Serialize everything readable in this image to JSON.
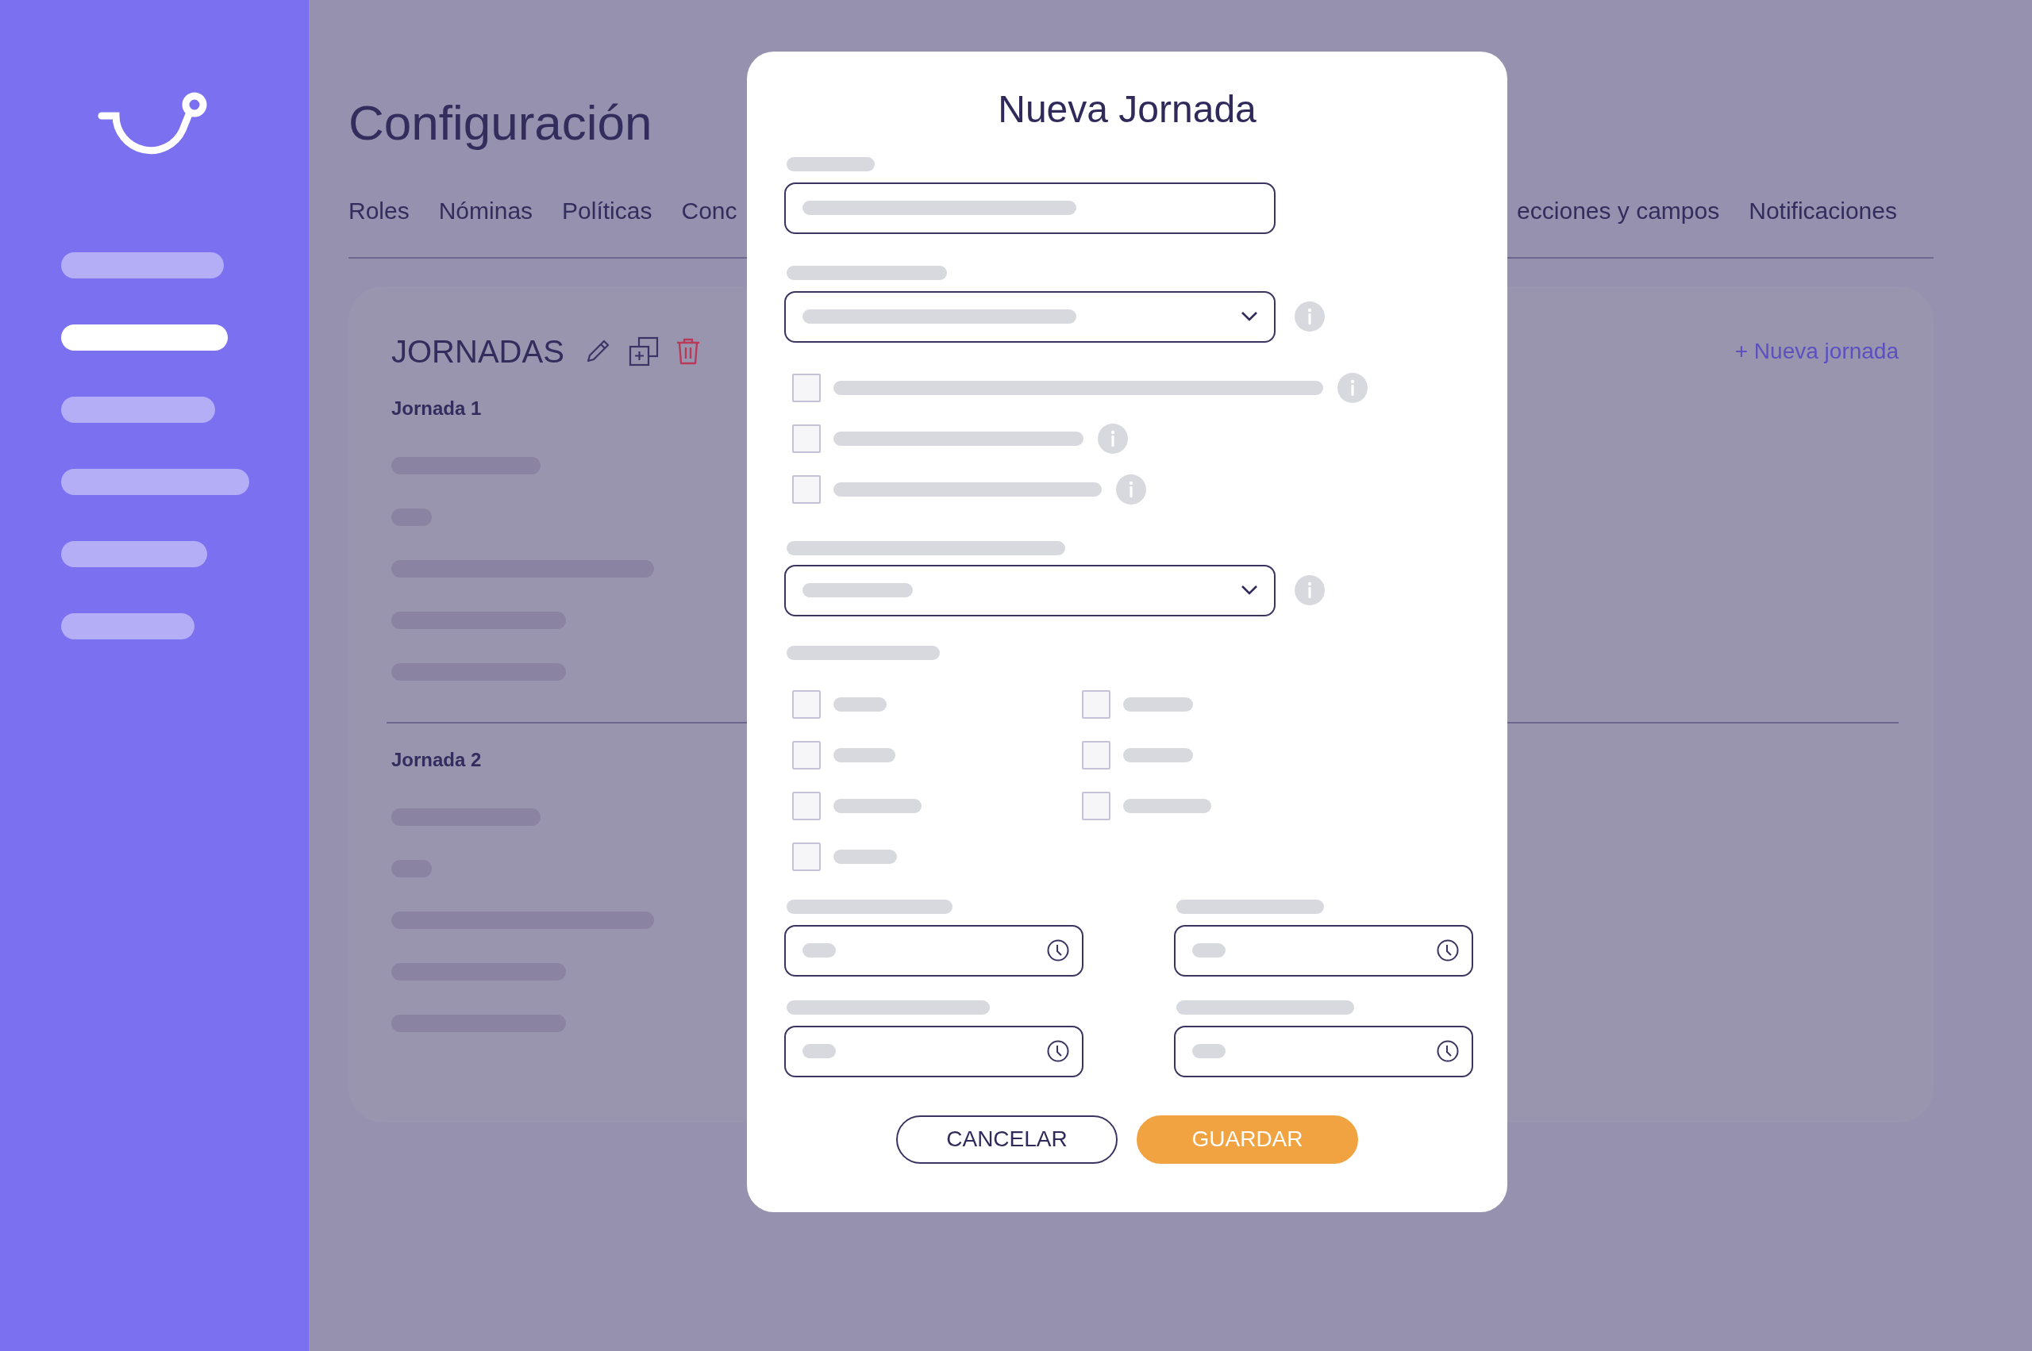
{
  "sidebar": {
    "items": [
      {
        "selected": false
      },
      {
        "selected": true
      },
      {
        "selected": false
      },
      {
        "selected": false
      },
      {
        "selected": false
      },
      {
        "selected": false
      }
    ]
  },
  "page": {
    "title": "Configuración"
  },
  "tabs": [
    {
      "label": "Roles"
    },
    {
      "label": "Nóminas"
    },
    {
      "label": "Políticas"
    },
    {
      "label": "Conc"
    },
    {
      "label": "ecciones y campos"
    },
    {
      "label": "Notificaciones"
    }
  ],
  "card": {
    "title": "JORNADAS",
    "add_link": "+ Nueva jornada",
    "sections": [
      {
        "title": "Jornada 1"
      },
      {
        "title": "Jornada 2"
      }
    ]
  },
  "dialog": {
    "title": "Nueva Jornada",
    "options": [
      {
        "checked": false,
        "info": true
      },
      {
        "checked": false,
        "info": true
      },
      {
        "checked": false,
        "info": true
      }
    ],
    "days": [
      {
        "checked": false
      },
      {
        "checked": false
      },
      {
        "checked": false
      },
      {
        "checked": false
      },
      {
        "checked": false
      },
      {
        "checked": false
      },
      {
        "checked": false
      }
    ],
    "buttons": [
      {
        "label": "CANCELAR",
        "kind": "secondary"
      },
      {
        "label": "GUARDAR",
        "kind": "primary"
      }
    ]
  }
}
